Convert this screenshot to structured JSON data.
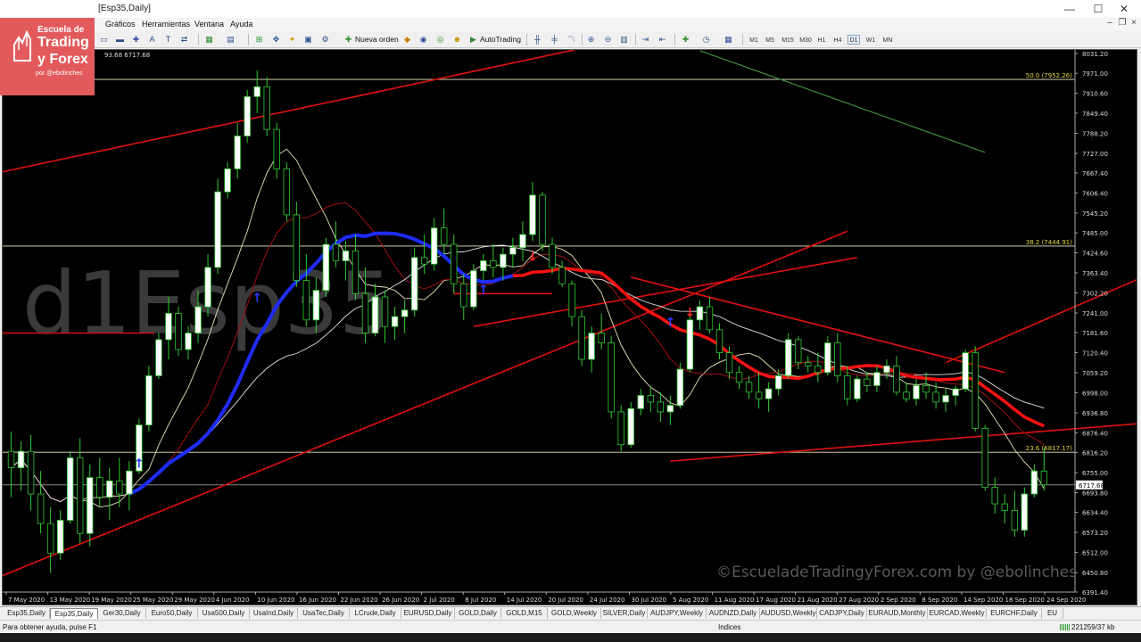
{
  "window": {
    "title": "[Esp35,Daily]",
    "minimize": "—",
    "maximize": "☐",
    "close": "✕"
  },
  "logo": {
    "line1": "Escuela de",
    "line2": "Trading",
    "line3": "y Forex",
    "line4": "por @ebolinches"
  },
  "menu": [
    "Gráficos",
    "Herramientas",
    "Ventana",
    "Ayuda"
  ],
  "toolbar": {
    "new_order": "Nueva orden",
    "autotrading": "AutoTrading",
    "timeframes": [
      "M1",
      "M5",
      "M15",
      "M30",
      "H1",
      "H4",
      "D1",
      "W1",
      "MN"
    ],
    "active_timeframe": "D1"
  },
  "chart": {
    "ohlc_label": "93.68 6717.68",
    "watermark": "d1Esp35",
    "copyright": "©EscueladeTradingyForex.com by @ebolinches",
    "price_labels": [
      "8031.20",
      "7971.00",
      "7910.60",
      "7849.40",
      "7788.20",
      "7727.00",
      "7667.40",
      "7606.40",
      "7545.20",
      "7485.00",
      "7424.60",
      "7363.40",
      "7302.20",
      "7241.00",
      "7181.60",
      "7120.40",
      "7059.20",
      "6998.00",
      "6936.80",
      "6876.40",
      "6816.20",
      "6755.00",
      "6693.80",
      "6634.40",
      "6573.20",
      "6512.00",
      "6450.80",
      "6391.40"
    ],
    "current_price": "6717.68",
    "fib_labels": [
      "50.0 (7952.26)",
      "38.2 (7444.91)",
      "23.6 (6817.17)"
    ],
    "date_labels": [
      "7 May 2020",
      "13 May 2020",
      "19 May 2020",
      "25 May 2020",
      "29 May 2020",
      "4 Jun 2020",
      "10 Jun 2020",
      "16 Jun 2020",
      "22 Jun 2020",
      "26 Jun 2020",
      "2 Jul 2020",
      "8 Jul 2020",
      "14 Jul 2020",
      "20 Jul 2020",
      "24 Jul 2020",
      "30 Jul 2020",
      "5 Aug 2020",
      "11 Aug 2020",
      "17 Aug 2020",
      "21 Aug 2020",
      "27 Aug 2020",
      "2 Sep 2020",
      "8 Sep 2020",
      "14 Sep 2020",
      "18 Sep 2020",
      "24 Sep 2020"
    ],
    "colors": {
      "background": "#000000",
      "bull": "#ffffff",
      "bear": "#000000",
      "wick": "#2ecc2e",
      "ma_blue": "#1f2cff",
      "ma_red": "#ff1111",
      "trendline": "#e01010",
      "fib": "#e8e8c0"
    }
  },
  "chart_data": {
    "type": "candlestick",
    "symbol": "Esp35",
    "timeframe": "Daily",
    "ylim": [
      6391.4,
      8031.2
    ],
    "candles": [
      [
        6820,
        6880,
        6680,
        6770
      ],
      [
        6770,
        6850,
        6700,
        6820
      ],
      [
        6820,
        6870,
        6640,
        6690
      ],
      [
        6690,
        6760,
        6570,
        6600
      ],
      [
        6600,
        6650,
        6450,
        6510
      ],
      [
        6510,
        6640,
        6490,
        6610
      ],
      [
        6610,
        6820,
        6600,
        6800
      ],
      [
        6800,
        6860,
        6540,
        6570
      ],
      [
        6570,
        6780,
        6530,
        6740
      ],
      [
        6740,
        6800,
        6650,
        6680
      ],
      [
        6680,
        6770,
        6610,
        6730
      ],
      [
        6730,
        6800,
        6650,
        6690
      ],
      [
        6690,
        6790,
        6640,
        6760
      ],
      [
        6760,
        6920,
        6750,
        6900
      ],
      [
        6900,
        7080,
        6880,
        7050
      ],
      [
        7050,
        7180,
        7040,
        7160
      ],
      [
        7160,
        7290,
        7100,
        7240
      ],
      [
        7240,
        7260,
        7110,
        7130
      ],
      [
        7130,
        7200,
        7100,
        7180
      ],
      [
        7180,
        7310,
        7150,
        7260
      ],
      [
        7260,
        7420,
        7230,
        7380
      ],
      [
        7380,
        7650,
        7360,
        7610
      ],
      [
        7610,
        7700,
        7590,
        7680
      ],
      [
        7680,
        7820,
        7650,
        7780
      ],
      [
        7780,
        7920,
        7760,
        7900
      ],
      [
        7900,
        7980,
        7850,
        7930
      ],
      [
        7930,
        7960,
        7780,
        7800
      ],
      [
        7800,
        7820,
        7650,
        7680
      ],
      [
        7680,
        7700,
        7520,
        7540
      ],
      [
        7540,
        7580,
        7320,
        7340
      ],
      [
        7340,
        7420,
        7200,
        7220
      ],
      [
        7220,
        7350,
        7180,
        7310
      ],
      [
        7310,
        7470,
        7290,
        7450
      ],
      [
        7450,
        7520,
        7380,
        7400
      ],
      [
        7400,
        7460,
        7340,
        7430
      ],
      [
        7430,
        7480,
        7280,
        7300
      ],
      [
        7300,
        7380,
        7150,
        7180
      ],
      [
        7180,
        7330,
        7170,
        7290
      ],
      [
        7290,
        7310,
        7150,
        7200
      ],
      [
        7200,
        7260,
        7160,
        7230
      ],
      [
        7230,
        7280,
        7180,
        7250
      ],
      [
        7250,
        7440,
        7230,
        7410
      ],
      [
        7410,
        7480,
        7360,
        7390
      ],
      [
        7390,
        7530,
        7370,
        7500
      ],
      [
        7500,
        7560,
        7420,
        7450
      ],
      [
        7450,
        7480,
        7300,
        7330
      ],
      [
        7330,
        7360,
        7220,
        7260
      ],
      [
        7260,
        7390,
        7250,
        7370
      ],
      [
        7370,
        7420,
        7340,
        7400
      ],
      [
        7400,
        7450,
        7350,
        7380
      ],
      [
        7380,
        7440,
        7340,
        7420
      ],
      [
        7420,
        7470,
        7380,
        7440
      ],
      [
        7440,
        7520,
        7400,
        7480
      ],
      [
        7480,
        7640,
        7460,
        7600
      ],
      [
        7600,
        7610,
        7430,
        7450
      ],
      [
        7450,
        7470,
        7360,
        7380
      ],
      [
        7380,
        7400,
        7320,
        7330
      ],
      [
        7330,
        7340,
        7200,
        7230
      ],
      [
        7230,
        7250,
        7080,
        7100
      ],
      [
        7100,
        7200,
        7060,
        7180
      ],
      [
        7180,
        7240,
        7130,
        7150
      ],
      [
        7150,
        7170,
        6920,
        6940
      ],
      [
        6940,
        6960,
        6820,
        6840
      ],
      [
        6840,
        6970,
        6830,
        6950
      ],
      [
        6950,
        7010,
        6930,
        6990
      ],
      [
        6990,
        7020,
        6940,
        6970
      ],
      [
        6970,
        7000,
        6910,
        6940
      ],
      [
        6940,
        6990,
        6900,
        6960
      ],
      [
        6960,
        7090,
        6950,
        7070
      ],
      [
        7070,
        7240,
        7060,
        7220
      ],
      [
        7220,
        7280,
        7190,
        7260
      ],
      [
        7260,
        7290,
        7180,
        7190
      ],
      [
        7190,
        7210,
        7100,
        7120
      ],
      [
        7120,
        7140,
        7040,
        7060
      ],
      [
        7060,
        7080,
        7010,
        7030
      ],
      [
        7030,
        7050,
        6980,
        7000
      ],
      [
        7000,
        7060,
        6950,
        6980
      ],
      [
        6980,
        7030,
        6940,
        7010
      ],
      [
        7010,
        7070,
        6990,
        7050
      ],
      [
        7050,
        7180,
        7040,
        7160
      ],
      [
        7160,
        7170,
        7070,
        7090
      ],
      [
        7090,
        7110,
        7060,
        7080
      ],
      [
        7080,
        7120,
        7030,
        7060
      ],
      [
        7060,
        7170,
        7050,
        7150
      ],
      [
        7150,
        7180,
        7030,
        7050
      ],
      [
        7050,
        7080,
        6960,
        6980
      ],
      [
        6980,
        7050,
        6970,
        7040
      ],
      [
        7040,
        7060,
        7000,
        7020
      ],
      [
        7020,
        7080,
        7000,
        7060
      ],
      [
        7060,
        7100,
        7040,
        7080
      ],
      [
        7080,
        7110,
        6990,
        7000
      ],
      [
        7000,
        7030,
        6970,
        6980
      ],
      [
        6980,
        7040,
        6960,
        7020
      ],
      [
        7020,
        7060,
        6980,
        7000
      ],
      [
        7000,
        7030,
        6950,
        6970
      ],
      [
        6970,
        7010,
        6940,
        6990
      ],
      [
        6990,
        7020,
        6960,
        7010
      ],
      [
        7010,
        7130,
        7000,
        7120
      ],
      [
        7120,
        7140,
        6880,
        6890
      ],
      [
        6890,
        6900,
        6700,
        6710
      ],
      [
        6710,
        6740,
        6630,
        6660
      ],
      [
        6660,
        6690,
        6600,
        6640
      ],
      [
        6640,
        6700,
        6560,
        6580
      ],
      [
        6580,
        6710,
        6560,
        6690
      ],
      [
        6690,
        6780,
        6680,
        6760
      ],
      [
        6760,
        6830,
        6700,
        6717.68
      ]
    ],
    "fib_levels": [
      7952.26,
      7444.91,
      6817.17
    ],
    "current_price": 6717.68
  },
  "tabs": [
    "Esp35,Daily",
    "Esp35,Daily",
    "Ger30,Daily",
    "Euro50,Daily",
    "Usa500,Daily",
    "UsaInd,Daily",
    "UsaTec,Daily",
    "LCrude,Daily",
    "EURUSD,Daily",
    "GOLD,Daily",
    "GOLD,M15",
    "GOLD,Weekly",
    "SILVER,Daily",
    "AUDJPY,Weekly",
    "AUDNZD,Daily",
    "AUDUSD,Weekly",
    "CADJPY,Daily",
    "EURAUD,Monthly",
    "EURCAD,Weekly",
    "EURCHF,Daily",
    "EU"
  ],
  "active_tab": 1,
  "status": {
    "help": "Para obtener ayuda, pulse F1",
    "section": "Indices",
    "traffic": "221259/37 kb"
  }
}
